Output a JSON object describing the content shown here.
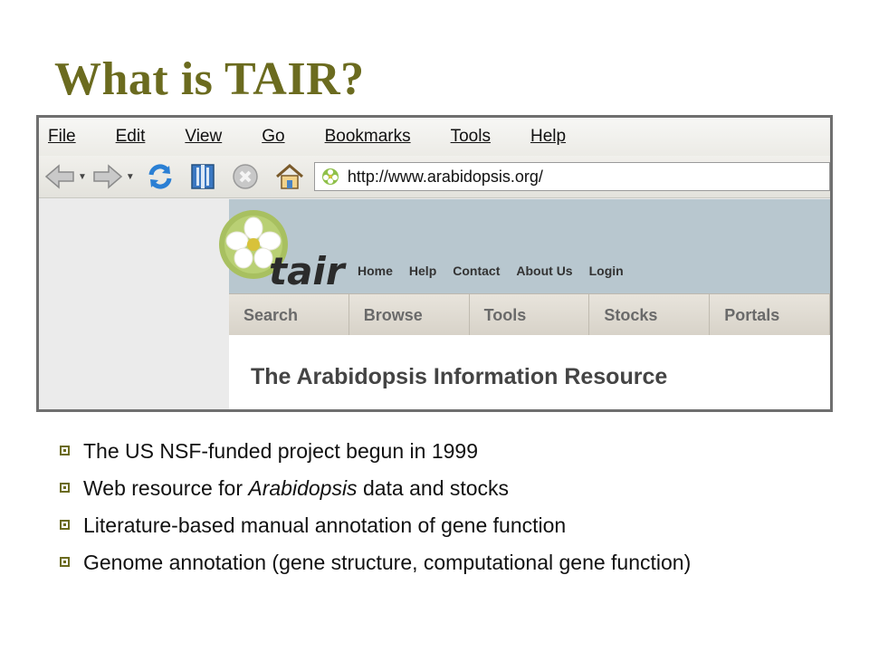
{
  "slide": {
    "title": "What is TAIR?"
  },
  "browser": {
    "menu": [
      "File",
      "Edit",
      "View",
      "Go",
      "Bookmarks",
      "Tools",
      "Help"
    ],
    "url": "http://www.arabidopsis.org/",
    "icons": [
      "back-icon",
      "forward-icon",
      "reload-icon",
      "bookmarks-icon",
      "stop-icon",
      "home-icon",
      "site-favicon"
    ]
  },
  "tair": {
    "logo_word": "tair",
    "top_links": [
      "Home",
      "Help",
      "Contact",
      "About Us",
      "Login"
    ],
    "tabs": [
      "Search",
      "Browse",
      "Tools",
      "Stocks",
      "Portals"
    ],
    "heading": "The Arabidopsis Information Resource"
  },
  "bullets": [
    "The US NSF-funded project begun in 1999",
    {
      "pre": "Web resource for ",
      "em": "Arabidopsis",
      "post": " data and stocks"
    },
    "Literature-based manual annotation of gene function",
    "Genome annotation (gene structure, computational gene function)"
  ],
  "colors": {
    "title": "#6b6b1f",
    "header_band": "#b8c7cf",
    "bullet": "#6b6b1f"
  }
}
